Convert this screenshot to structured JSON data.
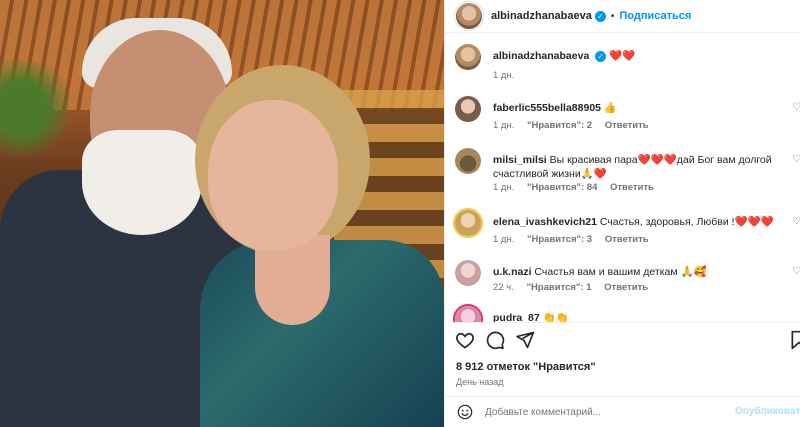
{
  "post": {
    "author": "albinadzhanabaeva",
    "follow_label": "Подписаться",
    "caption_emoji": "❤️❤️",
    "caption_time": "1 дн.",
    "separator": "•",
    "verified_mark": "✓"
  },
  "comments": [
    {
      "user": "faberlic555bella88905",
      "text": " 👍",
      "time": "1 дн.",
      "likes": "\"Нравится\": 2",
      "reply": "Ответить"
    },
    {
      "user": "milsi_milsi",
      "text": " Вы красивая пара❤️❤️❤️дай Бог вам долгой счастливой жизни🙏❤️",
      "time": "1 дн.",
      "likes": "\"Нравится\": 84",
      "reply": "Ответить"
    },
    {
      "user": "elena_ivashkevich21",
      "text": " Счастья, здоровья, Любви !❤️❤️❤️",
      "time": "1 дн.",
      "likes": "\"Нравится\": 3",
      "reply": "Ответить"
    },
    {
      "user": "u.k.nazi",
      "text": " Счастья вам и вашим деткам 🙏🥰",
      "time": "22 ч.",
      "likes": "\"Нравится\": 1",
      "reply": "Ответить"
    },
    {
      "user": "pudra_87",
      "text": " 👏👏",
      "time": "",
      "likes": "",
      "reply": ""
    }
  ],
  "stats": {
    "likes_text": "8 912 отметок \"Нравится\"",
    "posted": "День назад"
  },
  "composer": {
    "placeholder": "Добавьте комментарий...",
    "publish_label": "Опубликовать"
  },
  "colors": {
    "accent": "#0095f6",
    "heart": "#e0245e",
    "muted": "#737373"
  },
  "icons": [
    "heart-icon",
    "comment-icon",
    "share-icon",
    "bookmark-icon",
    "emoji-icon",
    "verified-badge-icon"
  ]
}
